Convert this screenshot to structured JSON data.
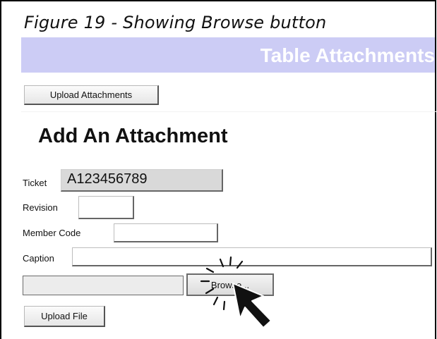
{
  "figure_caption": "Figure 19 - Showing Browse button",
  "header": {
    "title": "Table Attachments"
  },
  "toolbar": {
    "upload_attachments_label": "Upload Attachments"
  },
  "section": {
    "heading": "Add An Attachment"
  },
  "form": {
    "ticket_label": "Ticket",
    "ticket_value": "A123456789",
    "revision_label": "Revision",
    "revision_value": "",
    "member_code_label": "Member Code",
    "member_code_value": "",
    "caption_label": "Caption",
    "caption_value": "",
    "file_path_value": "",
    "browse_label": "Browse...",
    "upload_file_label": "Upload File"
  },
  "colors": {
    "header_bg": "#ccccf5",
    "header_text": "#ffffff"
  },
  "icons": {
    "pointer": "mouse-pointer-icon",
    "click": "click-burst-icon"
  }
}
